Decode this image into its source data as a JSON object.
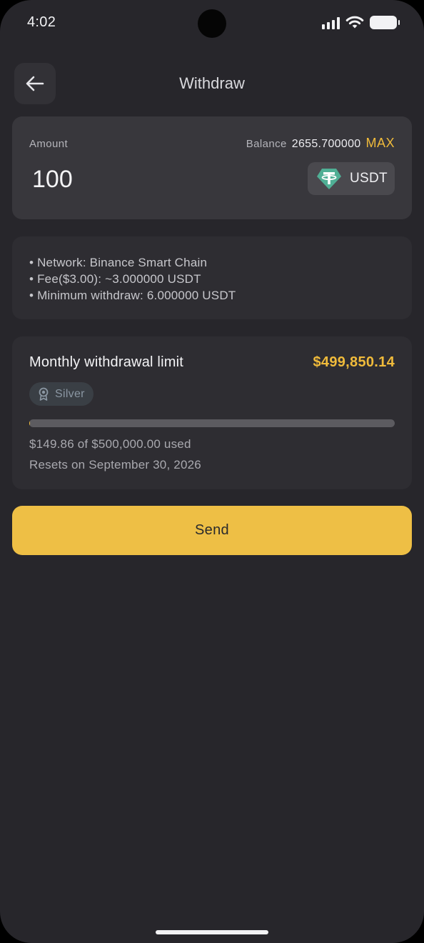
{
  "status_bar": {
    "time": "4:02"
  },
  "header": {
    "title": "Withdraw",
    "back_icon": "arrow-left-icon"
  },
  "amount_card": {
    "amount_label": "Amount",
    "amount_value": "100",
    "balance_label": "Balance",
    "balance_value": "2655.700000",
    "max_label": "MAX",
    "token": {
      "symbol": "USDT",
      "icon": "tether-icon",
      "icon_color": "#50af95"
    }
  },
  "info": {
    "lines": [
      "• Network: Binance Smart Chain",
      "• Fee($3.00): ~3.000000 USDT",
      "• Minimum withdraw: 6.000000 USDT"
    ]
  },
  "limit": {
    "title": "Monthly withdrawal limit",
    "remaining": "$499,850.14",
    "tier": "Silver",
    "tier_icon": "medal-icon",
    "used_fraction": 0.0003,
    "used_text": "$149.86 of $500,000.00 used",
    "reset_text": "Resets on September 30, 2026"
  },
  "actions": {
    "send_label": "Send"
  },
  "colors": {
    "background": "#27262b",
    "accent": "#f0bb3b",
    "button": "#eebf45"
  }
}
